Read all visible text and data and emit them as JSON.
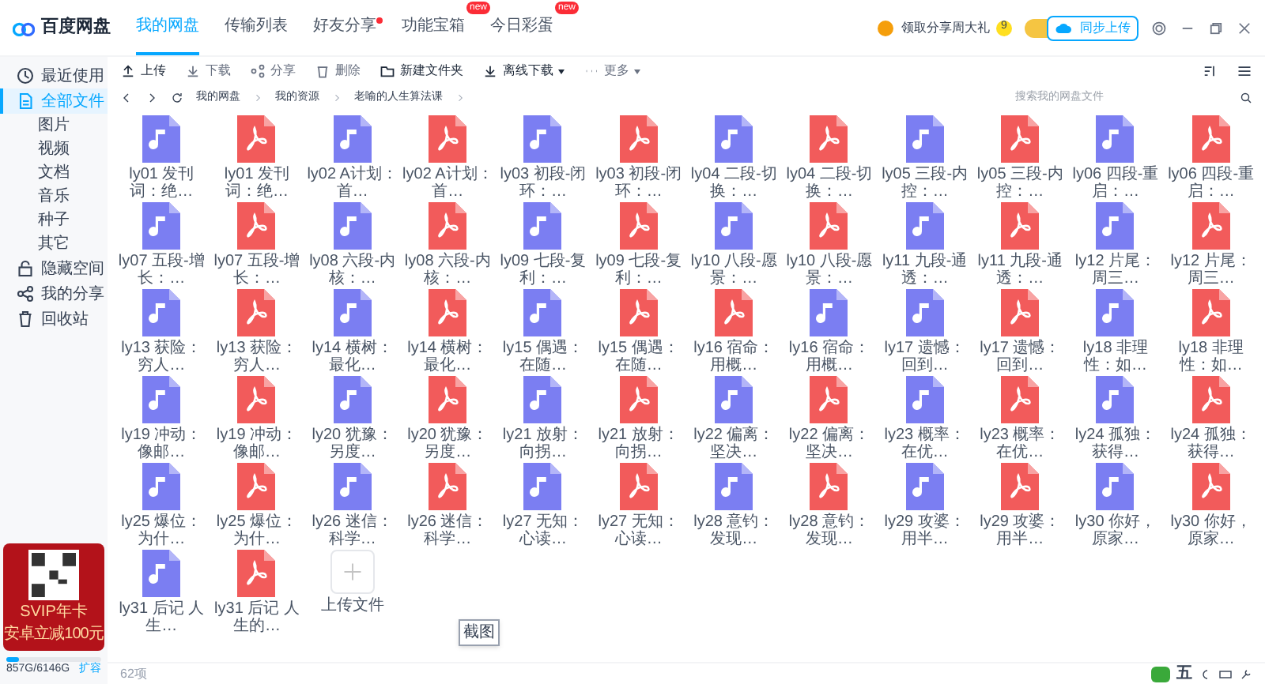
{
  "app": {
    "title": "百度网盘"
  },
  "tabs": [
    {
      "label": "我的网盘",
      "selected": true
    },
    {
      "label": "传输列表",
      "selected": false
    },
    {
      "label": "好友分享",
      "selected": false,
      "dot": true
    },
    {
      "label": "功能宝箱",
      "selected": false,
      "badge": "new"
    },
    {
      "label": "今日彩蛋",
      "selected": false,
      "badge": "new"
    }
  ],
  "promo": {
    "text": "领取分享周大礼",
    "count": "9"
  },
  "upload_popup": {
    "label": "同步上传"
  },
  "sidebar": {
    "items": [
      {
        "label": "最近使用",
        "selected": false
      },
      {
        "label": "全部文件",
        "selected": true,
        "children": [
          {
            "label": "图片"
          },
          {
            "label": "视频"
          },
          {
            "label": "文档"
          },
          {
            "label": "音乐"
          },
          {
            "label": "种子"
          },
          {
            "label": "其它"
          }
        ]
      },
      {
        "label": "隐藏空间",
        "selected": false
      },
      {
        "label": "我的分享",
        "selected": false
      },
      {
        "label": "回收站",
        "selected": false
      }
    ],
    "ad": {
      "line1": "SVIP年卡",
      "line2": "安卓立减100元"
    },
    "storage": {
      "text": "857G/6146G",
      "level": 0.14,
      "action": "扩容"
    }
  },
  "toolbar": [
    {
      "label": "上传",
      "disabled": false,
      "caret": false
    },
    {
      "label": "下载",
      "disabled": true,
      "caret": false
    },
    {
      "label": "分享",
      "disabled": true,
      "caret": false
    },
    {
      "label": "删除",
      "disabled": true,
      "caret": false
    },
    {
      "label": "新建文件夹",
      "disabled": false,
      "caret": false
    },
    {
      "label": "离线下载",
      "disabled": false,
      "caret": true
    },
    {
      "label": "更多",
      "disabled": true,
      "caret": true
    }
  ],
  "breadcrumb": [
    "我的网盘",
    "我的资源",
    "老喻的人生算法课"
  ],
  "search": {
    "placeholder": "搜索我的网盘文件"
  },
  "files": [
    {
      "name": "ly01 发刊词：绝…",
      "kind": "audio"
    },
    {
      "name": "ly01 发刊词：绝…",
      "kind": "pdf"
    },
    {
      "name": "ly02 A计划：首…",
      "kind": "audio"
    },
    {
      "name": "ly02 A计划：首…",
      "kind": "pdf"
    },
    {
      "name": "ly03 初段-闭环：…",
      "kind": "audio"
    },
    {
      "name": "ly03 初段-闭环：…",
      "kind": "pdf"
    },
    {
      "name": "ly04 二段-切换：…",
      "kind": "audio"
    },
    {
      "name": "ly04 二段-切换：…",
      "kind": "pdf"
    },
    {
      "name": "ly05 三段-内控：…",
      "kind": "audio"
    },
    {
      "name": "ly05 三段-内控：…",
      "kind": "pdf"
    },
    {
      "name": "ly06 四段-重启：…",
      "kind": "audio"
    },
    {
      "name": "ly06 四段-重启：…",
      "kind": "pdf"
    },
    {
      "name": "ly07 五段-增长：…",
      "kind": "audio"
    },
    {
      "name": "ly07 五段-增长：…",
      "kind": "pdf"
    },
    {
      "name": "ly08 六段-内核：…",
      "kind": "audio"
    },
    {
      "name": "ly08 六段-内核：…",
      "kind": "pdf"
    },
    {
      "name": "ly09 七段-复利：…",
      "kind": "audio"
    },
    {
      "name": "ly09 七段-复利：…",
      "kind": "pdf"
    },
    {
      "name": "ly10 八段-愿景：…",
      "kind": "audio"
    },
    {
      "name": "ly10 八段-愿景：…",
      "kind": "pdf"
    },
    {
      "name": "ly11 九段-通透：…",
      "kind": "audio"
    },
    {
      "name": "ly11 九段-通透：…",
      "kind": "pdf"
    },
    {
      "name": "ly12 片尾：周三…",
      "kind": "audio"
    },
    {
      "name": "ly12 片尾：周三…",
      "kind": "pdf"
    },
    {
      "name": "ly13 获险：穷人…",
      "kind": "audio"
    },
    {
      "name": "ly13 获险：穷人…",
      "kind": "pdf"
    },
    {
      "name": "ly14 横树：最化…",
      "kind": "audio"
    },
    {
      "name": "ly14 横树：最化…",
      "kind": "pdf"
    },
    {
      "name": "ly15 偶遇：在随…",
      "kind": "audio"
    },
    {
      "name": "ly15 偶遇：在随…",
      "kind": "pdf"
    },
    {
      "name": "ly16 宿命：用概…",
      "kind": "pdf"
    },
    {
      "name": "ly16 宿命：用概…",
      "kind": "audio"
    },
    {
      "name": "ly17 遗憾：回到…",
      "kind": "audio"
    },
    {
      "name": "ly17 遗憾：回到…",
      "kind": "pdf"
    },
    {
      "name": "ly18 非理性：如…",
      "kind": "audio"
    },
    {
      "name": "ly18 非理性：如…",
      "kind": "pdf"
    },
    {
      "name": "ly19 冲动：像邮…",
      "kind": "audio"
    },
    {
      "name": "ly19 冲动：像邮…",
      "kind": "pdf"
    },
    {
      "name": "ly20 犹豫：另度…",
      "kind": "audio"
    },
    {
      "name": "ly20 犹豫：另度…",
      "kind": "pdf"
    },
    {
      "name": "ly21 放射：向拐…",
      "kind": "audio"
    },
    {
      "name": "ly21 放射：向拐…",
      "kind": "pdf"
    },
    {
      "name": "ly22 偏离：坚决…",
      "kind": "audio"
    },
    {
      "name": "ly22 偏离：坚决…",
      "kind": "pdf"
    },
    {
      "name": "ly23 概率：在优…",
      "kind": "audio"
    },
    {
      "name": "ly23 概率：在优…",
      "kind": "pdf"
    },
    {
      "name": "ly24 孤独：获得…",
      "kind": "audio"
    },
    {
      "name": "ly24 孤独：获得…",
      "kind": "pdf"
    },
    {
      "name": "ly25 爆位：为什…",
      "kind": "audio"
    },
    {
      "name": "ly25 爆位：为什…",
      "kind": "pdf"
    },
    {
      "name": "ly26 迷信：科学…",
      "kind": "audio"
    },
    {
      "name": "ly26 迷信：科学…",
      "kind": "pdf"
    },
    {
      "name": "ly27 无知：心读…",
      "kind": "audio"
    },
    {
      "name": "ly27 无知：心读…",
      "kind": "pdf"
    },
    {
      "name": "ly28 意钓：发现…",
      "kind": "audio"
    },
    {
      "name": "ly28 意钓：发现…",
      "kind": "pdf"
    },
    {
      "name": "ly29 攻婆：用半…",
      "kind": "audio"
    },
    {
      "name": "ly29 攻婆：用半…",
      "kind": "pdf"
    },
    {
      "name": "ly30 你好，原家…",
      "kind": "audio"
    },
    {
      "name": "ly30 你好，原家…",
      "kind": "pdf"
    },
    {
      "name": "ly31 后记 人生…",
      "kind": "audio"
    },
    {
      "name": "ly31 后记 人生的…",
      "kind": "pdf"
    },
    {
      "name": "上传文件",
      "kind": "upload"
    }
  ],
  "tooltip": "截图",
  "status_bar": {
    "count": "62项",
    "ime": "五"
  }
}
